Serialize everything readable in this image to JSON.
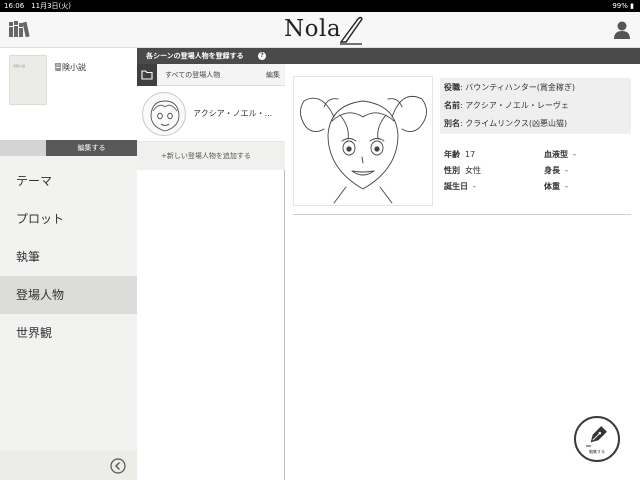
{
  "status_bar": {
    "time_date": "16:06　11月3日(火)",
    "battery": "99%"
  },
  "app": {
    "logo": "Nola"
  },
  "book": {
    "cover_text": "冒険小説",
    "title": "冒険小説",
    "edit_label": "編集する"
  },
  "nav": {
    "items": [
      {
        "label": "テーマ"
      },
      {
        "label": "プロット"
      },
      {
        "label": "執筆"
      },
      {
        "label": "登場人物",
        "active": true
      },
      {
        "label": "世界観"
      }
    ]
  },
  "scene_bar": {
    "label": "各シーンの登場人物を登録する",
    "help": "?"
  },
  "character_list": {
    "filter_label": "すべての登場人物",
    "edit_label": "編集",
    "items": [
      {
        "name": "アクシア・ノエル・..."
      }
    ],
    "add_label": "+新しい登場人物を追加する"
  },
  "character_detail": {
    "attributes": [
      {
        "key": "役職",
        "value": "バウンティハンター(賞金稼ぎ)"
      },
      {
        "key": "名前",
        "value": "アクシア・ノエル・レーヴェ"
      },
      {
        "key": "別名",
        "value": "クライムリンクス(凶悪山猫)"
      }
    ],
    "stats": {
      "age": {
        "key": "年齢",
        "value": "17"
      },
      "blood": {
        "key": "血液型",
        "value": "-"
      },
      "gender": {
        "key": "性別",
        "value": "女性"
      },
      "height": {
        "key": "身長",
        "value": "-"
      },
      "birthday": {
        "key": "誕生日",
        "value": "-"
      },
      "weight": {
        "key": "体重",
        "value": "-"
      }
    }
  },
  "fab": {
    "label": "編集する"
  }
}
